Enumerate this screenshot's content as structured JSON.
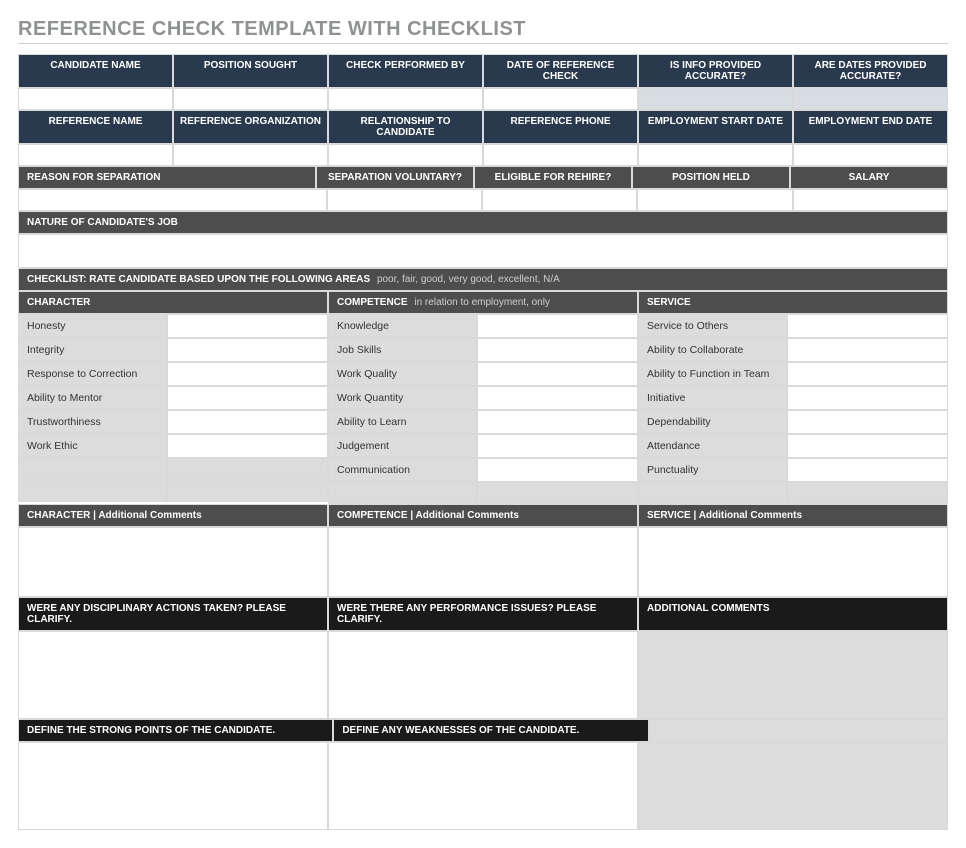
{
  "title": "REFERENCE CHECK TEMPLATE WITH CHECKLIST",
  "topHeaders": {
    "candidateName": "CANDIDATE NAME",
    "positionSought": "POSITION SOUGHT",
    "checkPerformedBy": "CHECK PERFORMED BY",
    "dateOfRefCheck": "DATE OF REFERENCE CHECK",
    "infoAccurate": "IS INFO PROVIDED ACCURATE?",
    "datesAccurate": "ARE DATES PROVIDED ACCURATE?"
  },
  "refHeaders": {
    "refName": "REFERENCE NAME",
    "refOrg": "REFERENCE ORGANIZATION",
    "relationship": "RELATIONSHIP TO CANDIDATE",
    "refPhone": "REFERENCE PHONE",
    "empStart": "EMPLOYMENT START DATE",
    "empEnd": "EMPLOYMENT END DATE"
  },
  "sepHeaders": {
    "reason": "REASON FOR SEPARATION",
    "voluntary": "SEPARATION VOLUNTARY?",
    "rehire": "ELIGIBLE FOR REHIRE?",
    "position": "POSITION HELD",
    "salary": "SALARY"
  },
  "natureHeader": "NATURE OF CANDIDATE'S JOB",
  "checklist": {
    "header": "CHECKLIST: RATE CANDIDATE BASED UPON THE FOLLOWING AREAS",
    "note": "poor, fair, good, very good, excellent, N/A",
    "cols": {
      "character": {
        "title": "CHARACTER",
        "sub": ""
      },
      "competence": {
        "title": "COMPETENCE",
        "sub": "in relation to employment, only"
      },
      "service": {
        "title": "SERVICE",
        "sub": ""
      }
    },
    "characterItems": [
      "Honesty",
      "Integrity",
      "Response to Correction",
      "Ability to Mentor",
      "Trustworthiness",
      "Work Ethic"
    ],
    "competenceItems": [
      "Knowledge",
      "Job Skills",
      "Work Quality",
      "Work Quantity",
      "Ability to Learn",
      "Judgement",
      "Communication"
    ],
    "serviceItems": [
      "Service to Others",
      "Ability to Collaborate",
      "Ability to Function in Team",
      "Initiative",
      "Dependability",
      "Attendance",
      "Punctuality"
    ]
  },
  "commentsHeaders": {
    "character": "CHARACTER  |  Additional Comments",
    "competence": "COMPETENCE  |  Additional Comments",
    "service": "SERVICE  |  Additional Comments"
  },
  "lowerHeaders": {
    "disciplinary": "WERE ANY DISCIPLINARY ACTIONS TAKEN? PLEASE CLARIFY.",
    "performance": "WERE THERE ANY PERFORMANCE ISSUES? PLEASE CLARIFY.",
    "additional": "ADDITIONAL COMMENTS",
    "strong": "DEFINE THE STRONG POINTS OF THE CANDIDATE.",
    "weak": "DEFINE ANY WEAKNESSES OF THE CANDIDATE."
  }
}
